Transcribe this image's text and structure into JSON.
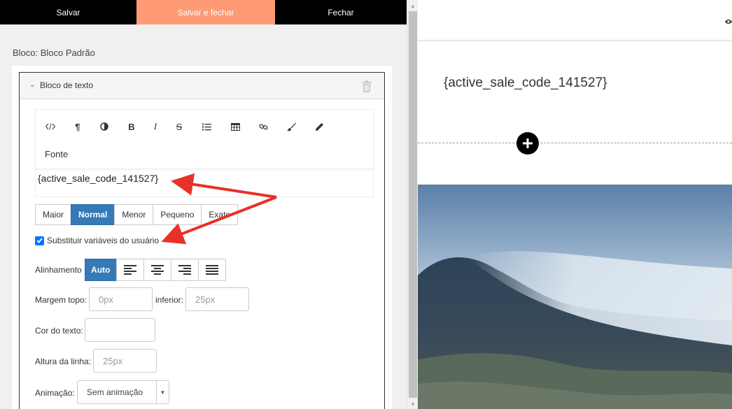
{
  "topbar": {
    "save_label": "Salvar",
    "save_close_label": "Salvar e fechar",
    "close_label": "Fechar",
    "accent": "#fe9a76"
  },
  "block": {
    "title": "Bloco: Bloco Padrão",
    "panel_title": "Bloco de texto"
  },
  "toolbar": {
    "icons": [
      "code-icon",
      "paragraph-icon",
      "contrast-icon",
      "bold-icon",
      "italic-icon",
      "strikethrough-icon",
      "list-icon",
      "table-icon",
      "link-icon",
      "brush-icon",
      "pencil-icon"
    ],
    "fonte_label": "Fonte"
  },
  "editor": {
    "content": "{active_sale_code_141527}"
  },
  "size": {
    "options": [
      "Maior",
      "Normal",
      "Menor",
      "Pequeno",
      "Exato"
    ],
    "selected": "Normal",
    "active_color": "#337ab7"
  },
  "substitute": {
    "label": "Substituir variáveis do usuário",
    "checked": true
  },
  "alignment": {
    "label": "Alinhamento",
    "auto_label": "Auto",
    "icons": [
      "align-left-icon",
      "align-center-icon",
      "align-right-icon",
      "align-justify-icon"
    ]
  },
  "margin": {
    "top_label": "Margem topo:",
    "top_placeholder": "0px",
    "bottom_label": "inferior:",
    "bottom_placeholder": "25px"
  },
  "text_color": {
    "label": "Cor do texto:"
  },
  "line_height": {
    "label": "Altura da linha:",
    "placeholder": "25px"
  },
  "animation": {
    "label": "Animação:",
    "selected": "Sem animação"
  },
  "preview": {
    "text": "{active_sale_code_141527}"
  }
}
